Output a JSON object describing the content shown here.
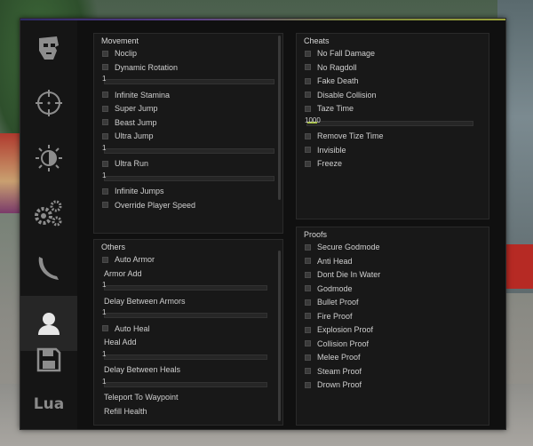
{
  "sidebar": {
    "items": [
      {
        "icon": "ghost-face-icon",
        "active": false
      },
      {
        "icon": "crosshair-icon",
        "active": false
      },
      {
        "icon": "brightness-icon",
        "active": false
      },
      {
        "icon": "gears-icon",
        "active": false
      },
      {
        "icon": "knife-icon",
        "active": false
      },
      {
        "icon": "user-icon",
        "active": true
      },
      {
        "icon": "save-icon",
        "active": false
      },
      {
        "icon": "lua-icon",
        "active": false,
        "label": "Lua"
      }
    ]
  },
  "panels": {
    "movement": {
      "title": "Movement",
      "rows": [
        {
          "type": "checkbox",
          "label": "Noclip"
        },
        {
          "type": "checkbox",
          "label": "Dynamic Rotation"
        },
        {
          "type": "slider",
          "value": "1",
          "fraction": 0.0
        },
        {
          "type": "checkbox",
          "label": "Infinite Stamina"
        },
        {
          "type": "checkbox",
          "label": "Super Jump"
        },
        {
          "type": "checkbox",
          "label": "Beast Jump"
        },
        {
          "type": "checkbox",
          "label": "Ultra Jump"
        },
        {
          "type": "slider",
          "value": "1",
          "fraction": 0.0
        },
        {
          "type": "checkbox",
          "label": "Ultra Run"
        },
        {
          "type": "slider",
          "value": "1",
          "fraction": 0.0
        },
        {
          "type": "checkbox",
          "label": "Infinite Jumps"
        },
        {
          "type": "checkbox",
          "label": "Override Player Speed"
        }
      ]
    },
    "cheats": {
      "title": "Cheats",
      "rows": [
        {
          "type": "checkbox",
          "label": "No Fall Damage"
        },
        {
          "type": "checkbox",
          "label": "No Ragdoll"
        },
        {
          "type": "checkbox",
          "label": "Fake Death"
        },
        {
          "type": "checkbox",
          "label": "Disable Collision"
        },
        {
          "type": "checkbox",
          "label": "Taze Time"
        },
        {
          "type": "slider",
          "value": "1000",
          "fraction": 0.06
        },
        {
          "type": "checkbox",
          "label": "Remove Tize Time"
        },
        {
          "type": "checkbox",
          "label": "Invisible"
        },
        {
          "type": "checkbox",
          "label": "Freeze"
        }
      ]
    },
    "others": {
      "title": "Others",
      "rows": [
        {
          "type": "checkbox",
          "label": "Auto Armor"
        },
        {
          "type": "text",
          "label": "Armor Add"
        },
        {
          "type": "slider",
          "value": "1",
          "fraction": 0.0
        },
        {
          "type": "text",
          "label": "Delay Between Armors"
        },
        {
          "type": "slider",
          "value": "1",
          "fraction": 0.0
        },
        {
          "type": "checkbox",
          "label": "Auto Heal"
        },
        {
          "type": "text",
          "label": "Heal Add"
        },
        {
          "type": "slider",
          "value": "1",
          "fraction": 0.0
        },
        {
          "type": "text",
          "label": "Delay Between Heals"
        },
        {
          "type": "slider",
          "value": "1",
          "fraction": 0.0
        },
        {
          "type": "text",
          "label": "Teleport To Waypoint"
        },
        {
          "type": "text",
          "label": "Refill Health"
        }
      ]
    },
    "proofs": {
      "title": "Proofs",
      "rows": [
        {
          "type": "checkbox",
          "label": "Secure Godmode"
        },
        {
          "type": "checkbox",
          "label": "Anti Head"
        },
        {
          "type": "checkbox",
          "label": "Dont Die In Water"
        },
        {
          "type": "checkbox",
          "label": "Godmode"
        },
        {
          "type": "checkbox",
          "label": "Bullet Proof"
        },
        {
          "type": "checkbox",
          "label": "Fire Proof"
        },
        {
          "type": "checkbox",
          "label": "Explosion Proof"
        },
        {
          "type": "checkbox",
          "label": "Collision Proof"
        },
        {
          "type": "checkbox",
          "label": "Melee Proof"
        },
        {
          "type": "checkbox",
          "label": "Steam Proof"
        },
        {
          "type": "checkbox",
          "label": "Drown Proof"
        }
      ]
    }
  },
  "colors": {
    "accent": "#a6c23a",
    "panel": "#181818",
    "window": "#101010"
  }
}
